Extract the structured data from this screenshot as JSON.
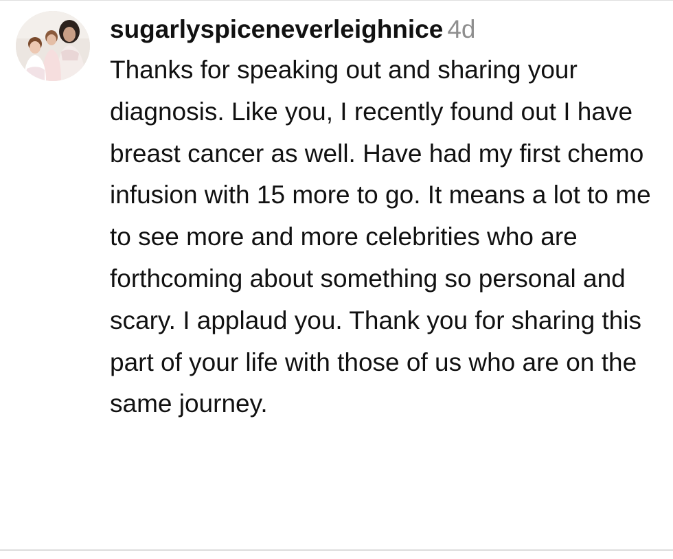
{
  "comment": {
    "avatar": "profile-photo-avatar",
    "username": "sugarlyspiceneverleighnice",
    "timestamp": "4d",
    "text": "Thanks for speaking out and sharing your diagnosis. Like you, I recently found out I have breast cancer as well. Have had my first chemo infusion with 15 more to go. It means a lot to me to see more and more celebrities who are forthcoming about something so personal and scary. I applaud you. Thank you for sharing this part of your life with those of us who are on the same journey."
  },
  "colors": {
    "text": "#111111",
    "timestamp": "#8e8e8e",
    "divider": "#dcdcdc",
    "background": "#ffffff"
  }
}
